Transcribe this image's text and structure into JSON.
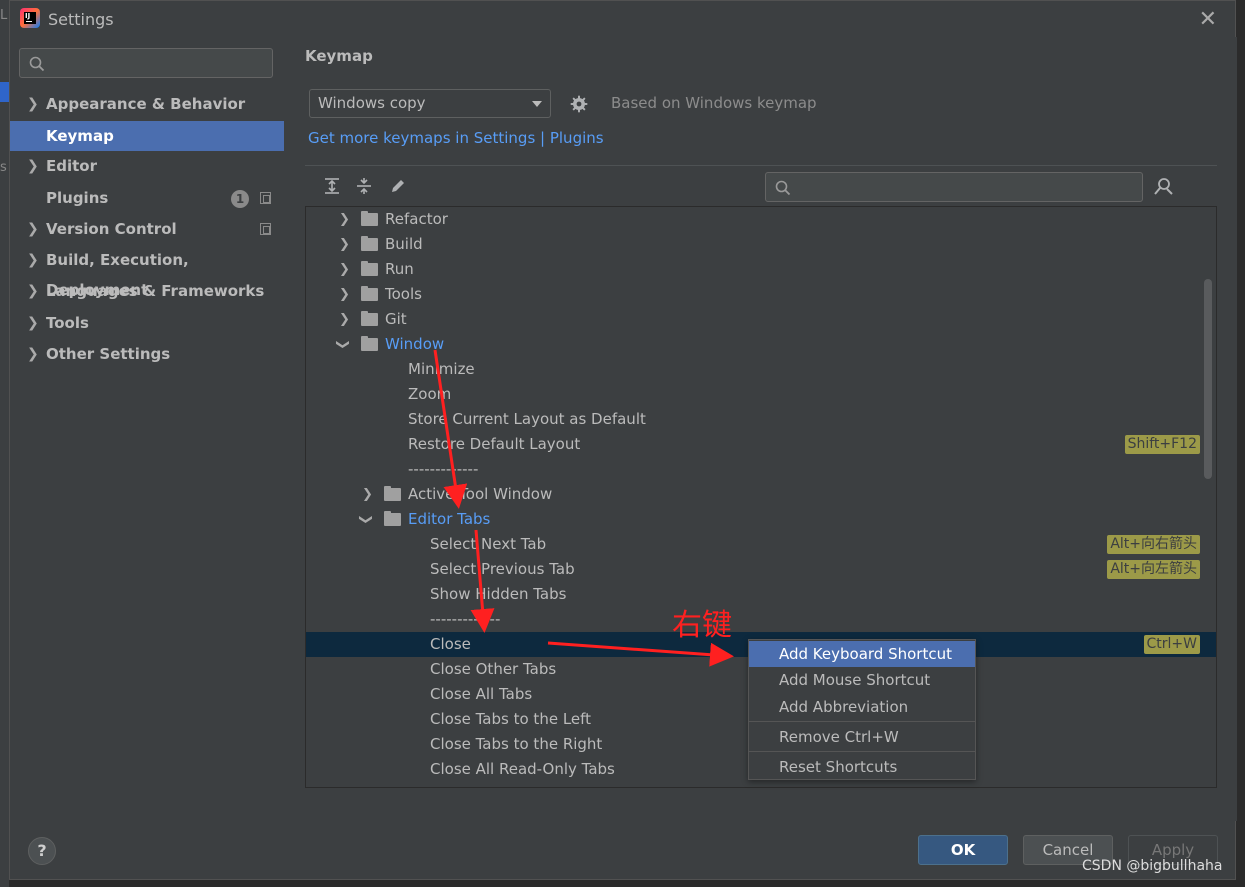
{
  "window": {
    "title": "Settings"
  },
  "background": {
    "char1": "L",
    "char2": "s"
  },
  "sidebar": {
    "items": [
      {
        "label": "Appearance & Behavior",
        "expandable": true
      },
      {
        "label": "Keymap",
        "expandable": false,
        "selected": true
      },
      {
        "label": "Editor",
        "expandable": true
      },
      {
        "label": "Plugins",
        "expandable": false,
        "badge": "1"
      },
      {
        "label": "Version Control",
        "expandable": true
      },
      {
        "label": "Build, Execution, Deployment",
        "expandable": true
      },
      {
        "label": "Languages & Frameworks",
        "expandable": true
      },
      {
        "label": "Tools",
        "expandable": true
      },
      {
        "label": "Other Settings",
        "expandable": true
      }
    ]
  },
  "main": {
    "title": "Keymap",
    "keymap_select": "Windows copy",
    "based_on": "Based on Windows keymap",
    "more_link": "Get more keymaps in Settings | Plugins"
  },
  "tree": {
    "rows": [
      {
        "label": "Refactor",
        "type": "folder",
        "state": "collapsed",
        "level": 0
      },
      {
        "label": "Build",
        "type": "folder",
        "state": "collapsed",
        "level": 0
      },
      {
        "label": "Run",
        "type": "folder",
        "state": "collapsed",
        "level": 0
      },
      {
        "label": "Tools",
        "type": "folder",
        "state": "collapsed",
        "level": 0
      },
      {
        "label": "Git",
        "type": "folder",
        "state": "collapsed",
        "level": 0
      },
      {
        "label": "Window",
        "type": "folder",
        "state": "expanded",
        "level": 0,
        "highlight": true
      },
      {
        "label": "Minimize",
        "type": "action",
        "level": 1
      },
      {
        "label": "Zoom",
        "type": "action",
        "level": 1
      },
      {
        "label": "Store Current Layout as Default",
        "type": "action",
        "level": 1
      },
      {
        "label": "Restore Default Layout",
        "type": "action",
        "level": 1,
        "shortcut": "Shift+F12"
      },
      {
        "label": "-------------",
        "type": "action",
        "level": 1
      },
      {
        "label": "Active Tool Window",
        "type": "folder",
        "state": "collapsed",
        "level": 1
      },
      {
        "label": "Editor Tabs",
        "type": "folder",
        "state": "expanded",
        "level": 1,
        "highlight": true
      },
      {
        "label": "Select Next Tab",
        "type": "action",
        "level": 2,
        "shortcut": "Alt+向右箭头"
      },
      {
        "label": "Select Previous Tab",
        "type": "action",
        "level": 2,
        "shortcut": "Alt+向左箭头"
      },
      {
        "label": "Show Hidden Tabs",
        "type": "action",
        "level": 2
      },
      {
        "label": "-------------",
        "type": "action",
        "level": 2
      },
      {
        "label": "Close",
        "type": "action",
        "level": 2,
        "shortcut": "Ctrl+W",
        "selected": true
      },
      {
        "label": "Close Other Tabs",
        "type": "action",
        "level": 2
      },
      {
        "label": "Close All Tabs",
        "type": "action",
        "level": 2
      },
      {
        "label": "Close Tabs to the Left",
        "type": "action",
        "level": 2
      },
      {
        "label": "Close Tabs to the Right",
        "type": "action",
        "level": 2
      },
      {
        "label": "Close All Read-Only Tabs",
        "type": "action",
        "level": 2
      }
    ]
  },
  "context_menu": {
    "items": [
      {
        "label": "Add Keyboard Shortcut",
        "active": true
      },
      {
        "label": "Add Mouse Shortcut"
      },
      {
        "label": "Add Abbreviation"
      },
      {
        "label": "Remove Ctrl+W"
      },
      {
        "label": "Reset Shortcuts"
      }
    ]
  },
  "buttons": {
    "help": "?",
    "ok": "OK",
    "cancel": "Cancel",
    "apply": "Apply"
  },
  "annotation": {
    "label": "右键",
    "color": "#ff2020"
  },
  "watermark": "CSDN @bigbullhaha",
  "colors": {
    "selection": "#4b6eaf",
    "link": "#589df6",
    "shortcut_bg": "#9c9a48",
    "tree_selected": "#0d293e"
  }
}
